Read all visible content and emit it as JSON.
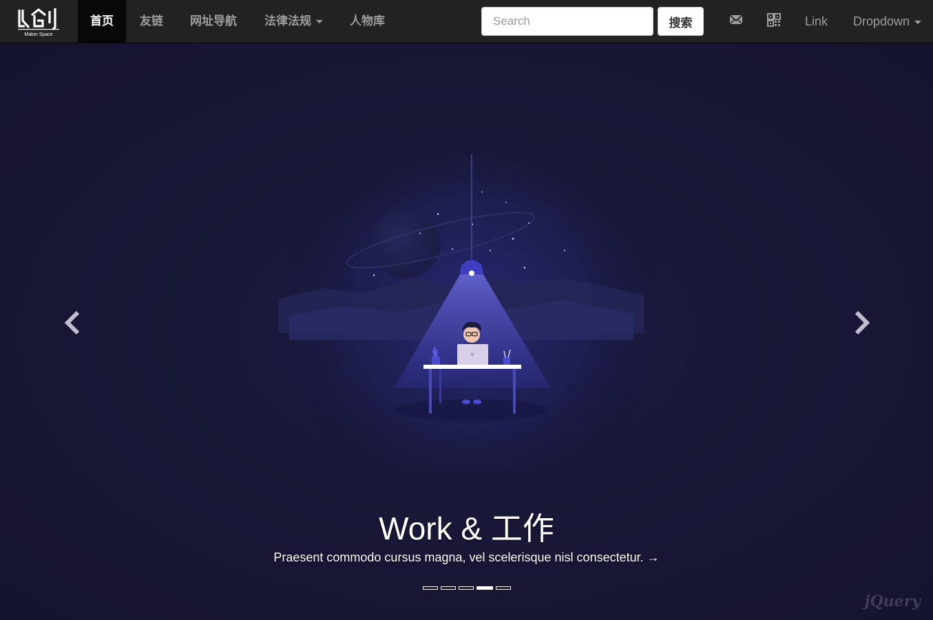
{
  "brand": {
    "logo_text": "凡创",
    "logo_subtext": "Maker Space"
  },
  "nav": {
    "items": [
      {
        "label": "首页",
        "active": true
      },
      {
        "label": "友链"
      },
      {
        "label": "网址导航"
      },
      {
        "label": "法律法规",
        "dropdown": true
      },
      {
        "label": "人物库"
      }
    ]
  },
  "search": {
    "placeholder": "Search",
    "button_label": "搜索"
  },
  "right_nav": {
    "mail_icon": "envelope-icon",
    "qr_icon": "qrcode-icon",
    "link_label": "Link",
    "dropdown_label": "Dropdown"
  },
  "carousel": {
    "caption_title": "Work & 工作",
    "caption_text": "Praesent commodo cursus magna, vel scelerisque nisl consectetur. →",
    "slide_count": 5,
    "active_index": 3,
    "prev_icon": "chevron-left-icon",
    "next_icon": "chevron-right-icon"
  },
  "watermark": {
    "text": "jQuery"
  },
  "colors": {
    "navbar": "#222222",
    "nav_text": "#9d9d9d",
    "nav_active_bg": "#080808",
    "hero_bg": "#15142e",
    "accent_blue": "#3f3fb5"
  }
}
